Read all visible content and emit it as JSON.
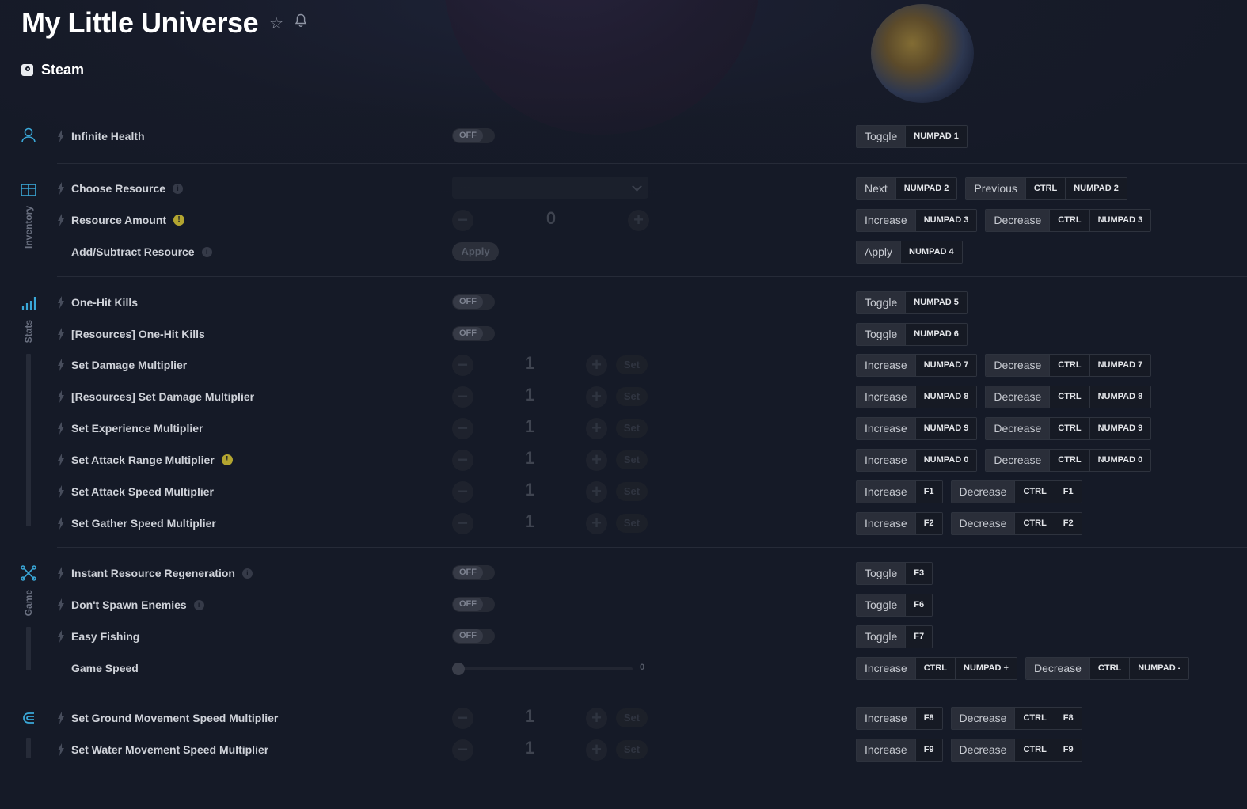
{
  "game": {
    "title": "My Little Universe",
    "platform": "Steam"
  },
  "categories": [
    {
      "label": "",
      "icon": "player-icon"
    },
    {
      "label": "Inventory",
      "icon": "box-icon"
    },
    {
      "label": "Stats",
      "icon": "bar-chart-icon"
    },
    {
      "label": "Game",
      "icon": "game-icon"
    },
    {
      "label": "",
      "icon": "magnet-icon"
    }
  ],
  "rows": [
    {
      "label": "Infinite Health",
      "control": "toggle",
      "state": "OFF",
      "hotkeys": [
        {
          "action": "Toggle",
          "keys": [
            "NUMPAD 1"
          ]
        }
      ]
    },
    {
      "label": "Choose Resource",
      "info": "i",
      "control": "select",
      "value": "---",
      "hotkeys": [
        {
          "action": "Next",
          "keys": [
            "NUMPAD 2"
          ]
        },
        {
          "action": "Previous",
          "keys": [
            "CTRL",
            "NUMPAD 2"
          ]
        }
      ]
    },
    {
      "label": "Resource Amount",
      "warn": "!",
      "control": "stepper-wide",
      "value": "0",
      "hotkeys": [
        {
          "action": "Increase",
          "keys": [
            "NUMPAD 3"
          ]
        },
        {
          "action": "Decrease",
          "keys": [
            "CTRL",
            "NUMPAD 3"
          ]
        }
      ]
    },
    {
      "label": "Add/Subtract Resource",
      "info": "i",
      "control": "apply",
      "button": "Apply",
      "hotkeys": [
        {
          "action": "Apply",
          "keys": [
            "NUMPAD 4"
          ]
        }
      ]
    },
    {
      "label": "One-Hit Kills",
      "control": "toggle",
      "state": "OFF",
      "hotkeys": [
        {
          "action": "Toggle",
          "keys": [
            "NUMPAD 5"
          ]
        }
      ]
    },
    {
      "label": "[Resources] One-Hit Kills",
      "control": "toggle",
      "state": "OFF",
      "hotkeys": [
        {
          "action": "Toggle",
          "keys": [
            "NUMPAD 6"
          ]
        }
      ]
    },
    {
      "label": "Set Damage Multiplier",
      "control": "stepper",
      "value": "1",
      "button": "Set",
      "hotkeys": [
        {
          "action": "Increase",
          "keys": [
            "NUMPAD 7"
          ]
        },
        {
          "action": "Decrease",
          "keys": [
            "CTRL",
            "NUMPAD 7"
          ]
        }
      ]
    },
    {
      "label": "[Resources] Set Damage Multiplier",
      "control": "stepper",
      "value": "1",
      "button": "Set",
      "hotkeys": [
        {
          "action": "Increase",
          "keys": [
            "NUMPAD 8"
          ]
        },
        {
          "action": "Decrease",
          "keys": [
            "CTRL",
            "NUMPAD 8"
          ]
        }
      ]
    },
    {
      "label": "Set Experience Multiplier",
      "control": "stepper",
      "value": "1",
      "button": "Set",
      "hotkeys": [
        {
          "action": "Increase",
          "keys": [
            "NUMPAD 9"
          ]
        },
        {
          "action": "Decrease",
          "keys": [
            "CTRL",
            "NUMPAD 9"
          ]
        }
      ]
    },
    {
      "label": "Set Attack Range Multiplier",
      "warn": "!",
      "control": "stepper",
      "value": "1",
      "button": "Set",
      "hotkeys": [
        {
          "action": "Increase",
          "keys": [
            "NUMPAD 0"
          ]
        },
        {
          "action": "Decrease",
          "keys": [
            "CTRL",
            "NUMPAD 0"
          ]
        }
      ]
    },
    {
      "label": "Set Attack Speed Multiplier",
      "control": "stepper",
      "value": "1",
      "button": "Set",
      "hotkeys": [
        {
          "action": "Increase",
          "keys": [
            "F1"
          ]
        },
        {
          "action": "Decrease",
          "keys": [
            "CTRL",
            "F1"
          ]
        }
      ]
    },
    {
      "label": "Set Gather Speed Multiplier",
      "control": "stepper",
      "value": "1",
      "button": "Set",
      "hotkeys": [
        {
          "action": "Increase",
          "keys": [
            "F2"
          ]
        },
        {
          "action": "Decrease",
          "keys": [
            "CTRL",
            "F2"
          ]
        }
      ]
    },
    {
      "label": "Instant Resource Regeneration",
      "info": "i",
      "control": "toggle",
      "state": "OFF",
      "hotkeys": [
        {
          "action": "Toggle",
          "keys": [
            "F3"
          ]
        }
      ]
    },
    {
      "label": "Don't Spawn Enemies",
      "info": "i",
      "control": "toggle",
      "state": "OFF",
      "hotkeys": [
        {
          "action": "Toggle",
          "keys": [
            "F6"
          ]
        }
      ]
    },
    {
      "label": "Easy Fishing",
      "control": "toggle",
      "state": "OFF",
      "hotkeys": [
        {
          "action": "Toggle",
          "keys": [
            "F7"
          ]
        }
      ]
    },
    {
      "label": "Game Speed",
      "control": "slider",
      "value": "0",
      "hotkeys": [
        {
          "action": "Increase",
          "keys": [
            "CTRL",
            "NUMPAD +"
          ]
        },
        {
          "action": "Decrease",
          "keys": [
            "CTRL",
            "NUMPAD -"
          ]
        }
      ]
    },
    {
      "label": "Set Ground Movement Speed Multiplier",
      "control": "stepper",
      "value": "1",
      "button": "Set",
      "hotkeys": [
        {
          "action": "Increase",
          "keys": [
            "F8"
          ]
        },
        {
          "action": "Decrease",
          "keys": [
            "CTRL",
            "F8"
          ]
        }
      ]
    },
    {
      "label": "Set Water Movement Speed Multiplier",
      "control": "stepper",
      "value": "1",
      "button": "Set",
      "hotkeys": [
        {
          "action": "Increase",
          "keys": [
            "F9"
          ]
        },
        {
          "action": "Decrease",
          "keys": [
            "CTRL",
            "F9"
          ]
        }
      ]
    }
  ],
  "colors": {
    "background": "#151a27",
    "accent": "#3aa8d8",
    "warning": "#b3a530"
  }
}
